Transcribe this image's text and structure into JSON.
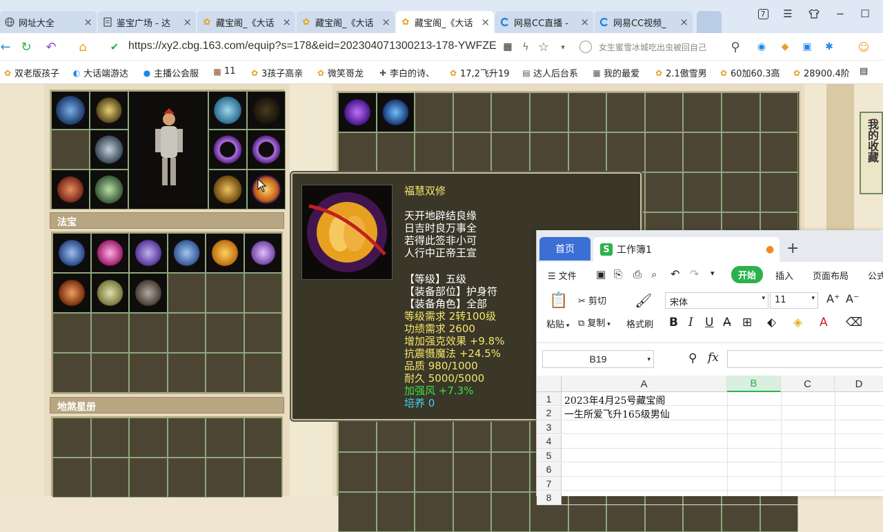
{
  "browser": {
    "tabs": [
      {
        "title": "网址大全",
        "icon": "globe-icon"
      },
      {
        "title": "鉴宝广场 - 达",
        "icon": "document-icon"
      },
      {
        "title": "藏宝阁_《大话",
        "icon": "cbg-logo-icon"
      },
      {
        "title": "藏宝阁_《大话",
        "icon": "cbg-logo-icon"
      },
      {
        "title": "藏宝阁_《大话",
        "icon": "cbg-logo-icon"
      },
      {
        "title": "网易CC直播 -",
        "icon": "cc-logo-icon"
      },
      {
        "title": "网易CC视频_",
        "icon": "cc-logo-icon"
      }
    ],
    "active_tab": 4,
    "tab_count_badge": "7",
    "url": "https://xy2.cbg.163.com/equip?s=178&eid=202304071300213-178-YWFZE",
    "search_placeholder": "女生蜜雪冰城吃出虫被回自己",
    "bookmarks": [
      "双老版孩子",
      "大话端游达",
      "主播公会服",
      "11",
      "3孩子高亲",
      "微笑哥龙",
      "李白的诗、",
      "17,2飞升19",
      "达人后台系",
      "我的最爱",
      "2.1傲雪男",
      "60加60.3高",
      "28900.4阶"
    ]
  },
  "game": {
    "section_fabao": "法宝",
    "section_xingce": "地煞星册",
    "side_tab": "我的收藏",
    "tooltip": {
      "name": "福慧双修",
      "poem": [
        "天开地辟结良缘",
        "日吉时良万事全",
        "若得此签非小可",
        "人行中正帝王宣"
      ],
      "level": "【等级】五级",
      "slot": "【装备部位】护身符",
      "role": "【装备角色】全部",
      "req_level": "等级需求 2转100级",
      "req_merit": "功绩需求 2600",
      "stat1": "增加强克效果 +9.8%",
      "stat2": "抗震慑魔法 +24.5%",
      "quality": "品质 980/1000",
      "durability": "耐久 5000/5000",
      "bonus": "加强风 +7.3%",
      "cultivate": "培养 0"
    }
  },
  "spreadsheet": {
    "home_tab": "首页",
    "doc_tab": "工作簿1",
    "menu_file": "文件",
    "menu_start": "开始",
    "menu_insert": "插入",
    "menu_layout": "页面布局",
    "menu_formula": "公式",
    "cut": "剪切",
    "copy": "复制",
    "paste": "粘贴",
    "format_painter": "格式刷",
    "font_name": "宋体",
    "font_size": "11",
    "cell_ref": "B19",
    "fx": "fx",
    "columns": [
      "A",
      "B",
      "C",
      "D"
    ],
    "rows": [
      "1",
      "2",
      "3",
      "4",
      "5",
      "6",
      "7",
      "8"
    ],
    "a1": "2023年4月25号藏宝阁",
    "a2": "一生所爱飞升165级男仙"
  },
  "colors": {
    "tooltip_yellow": "#f5e56a",
    "tooltip_white": "#ffffff",
    "tooltip_green": "#3fe03f",
    "tooltip_cyan": "#3fd3f0",
    "wps_green": "#2bb24c"
  }
}
